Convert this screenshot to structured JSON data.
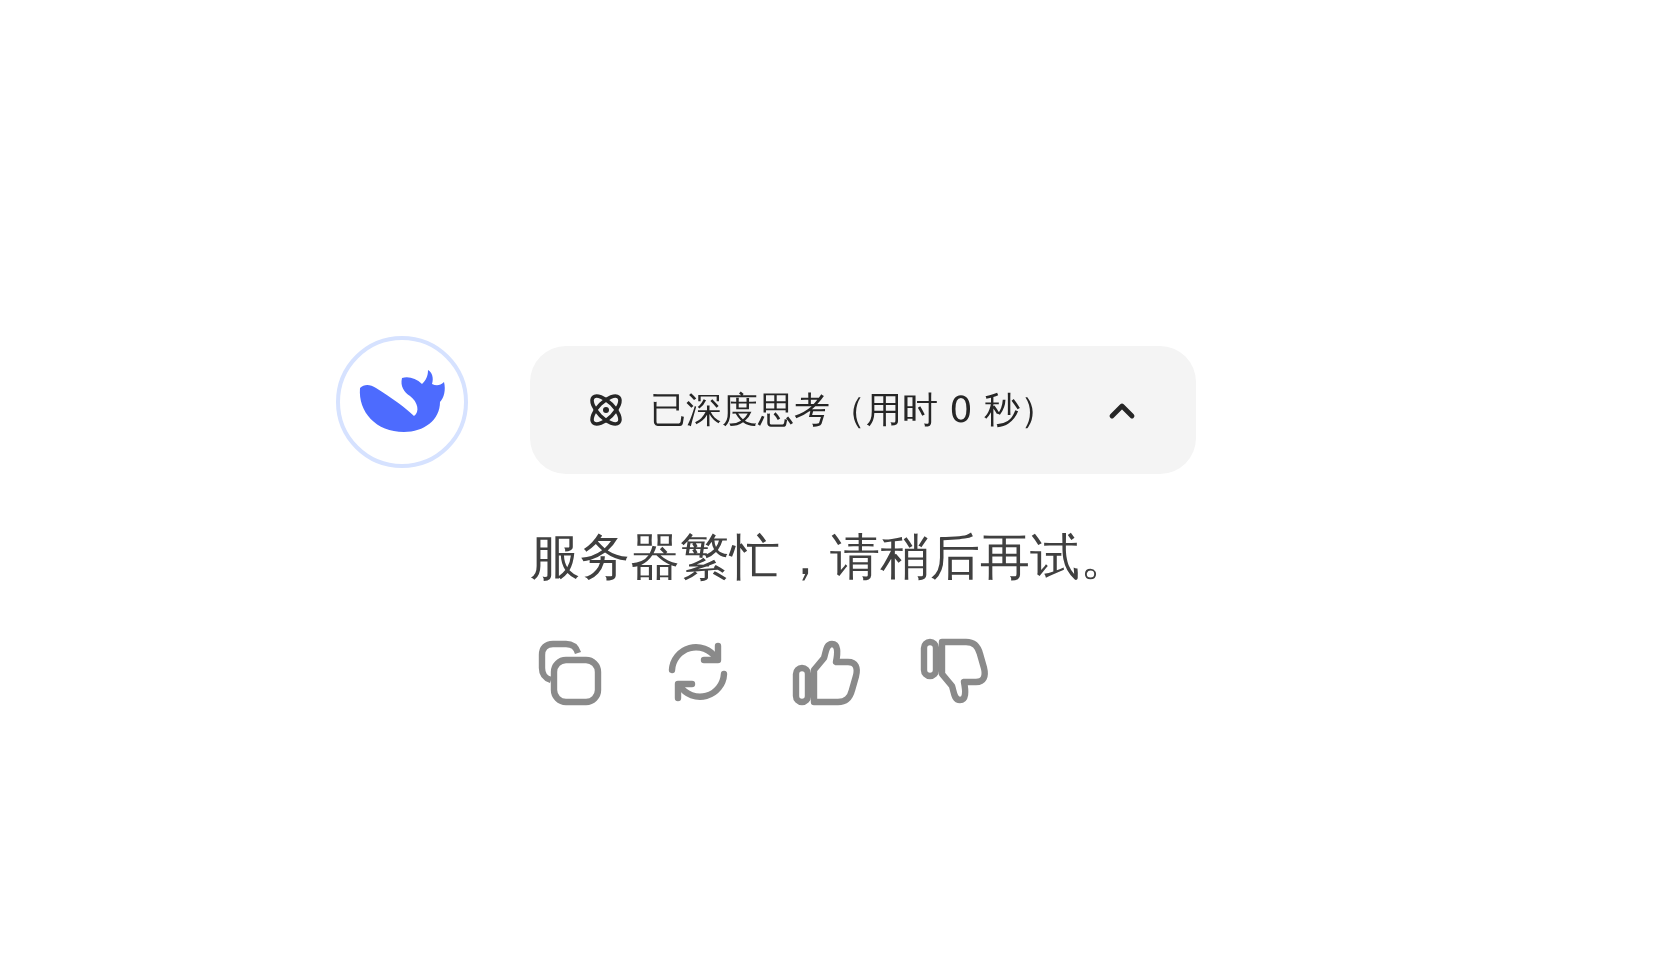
{
  "thinking": {
    "label": "已深度思考（用时 0 秒）",
    "expanded": true
  },
  "reply": "服务器繁忙，请稍后再试。",
  "actions": [
    {
      "kind": "copy"
    },
    {
      "kind": "regenerate"
    },
    {
      "kind": "like"
    },
    {
      "kind": "dislike"
    }
  ]
}
